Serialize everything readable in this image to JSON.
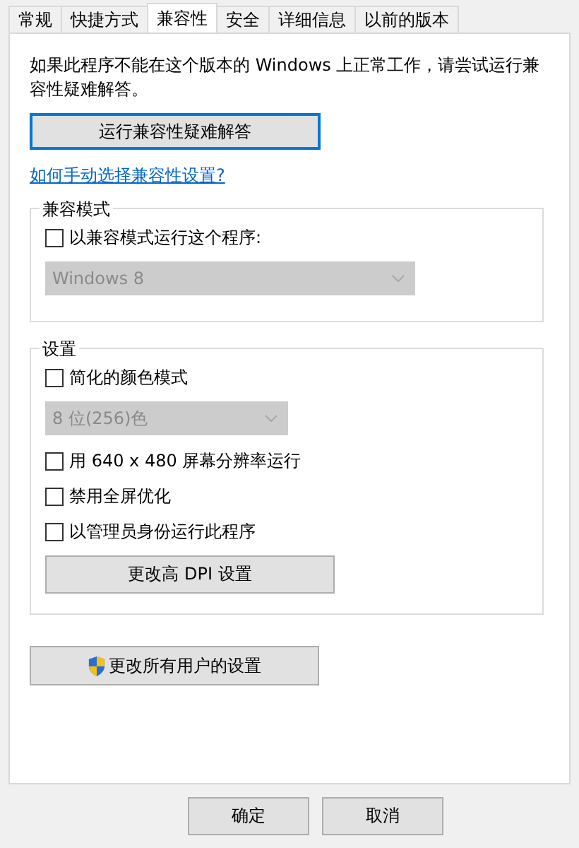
{
  "tabs": [
    {
      "label": "常规",
      "selected": false
    },
    {
      "label": "快捷方式",
      "selected": false
    },
    {
      "label": "兼容性",
      "selected": true
    },
    {
      "label": "安全",
      "selected": false
    },
    {
      "label": "详细信息",
      "selected": false
    },
    {
      "label": "以前的版本",
      "selected": false
    }
  ],
  "intro": "如果此程序不能在这个版本的 Windows 上正常工作，请尝试运行兼容性疑难解答。",
  "troubleshoot_button": "运行兼容性疑难解答",
  "help_link": "如何手动选择兼容性设置?",
  "groups": [
    {
      "title": "兼容模式",
      "items": [
        {
          "kind": "checkbox",
          "label": "以兼容模式运行这个程序:",
          "checked": false
        },
        {
          "kind": "dropdown",
          "value": "Windows 8",
          "disabled": true
        }
      ]
    },
    {
      "title": "设置",
      "items": [
        {
          "kind": "checkbox",
          "label": "简化的颜色模式",
          "checked": false
        },
        {
          "kind": "dropdown",
          "value": "8 位(256)色",
          "disabled": true
        },
        {
          "kind": "checkbox",
          "label": "用 640 x 480 屏幕分辨率运行",
          "checked": false
        },
        {
          "kind": "checkbox",
          "label": "禁用全屏优化",
          "checked": false
        },
        {
          "kind": "checkbox",
          "label": "以管理员身份运行此程序",
          "checked": false
        },
        {
          "kind": "button",
          "label": "更改高 DPI 设置"
        }
      ]
    }
  ],
  "all_users_button": "更改所有用户的设置",
  "dialog_buttons": [
    "确定",
    "取消"
  ]
}
